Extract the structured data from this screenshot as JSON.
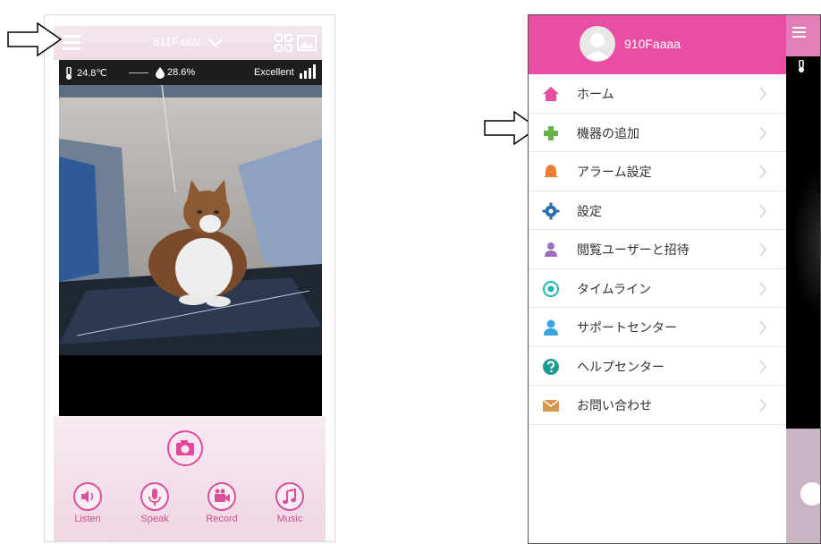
{
  "left_screen": {
    "device_name": "811Faaat",
    "temperature": "24.8℃",
    "humidity": "28.6%",
    "signal_label": "Excellent",
    "controls": [
      {
        "label": "Listen",
        "icon": "speaker-icon"
      },
      {
        "label": "Speak",
        "icon": "microphone-icon"
      },
      {
        "label": "Record",
        "icon": "video-camera-icon"
      },
      {
        "label": "Music",
        "icon": "music-note-icon"
      }
    ]
  },
  "right_screen": {
    "user_name": "910Faaaa",
    "menu_items": [
      {
        "label": "ホーム",
        "icon": "home-icon",
        "color": "#e94ea2"
      },
      {
        "label": "機器の追加",
        "icon": "plus-icon",
        "color": "#6bb24a"
      },
      {
        "label": "アラーム設定",
        "icon": "bell-icon",
        "color": "#f07b32"
      },
      {
        "label": "設定",
        "icon": "gear-icon",
        "color": "#2a6fb0"
      },
      {
        "label": "閲覧ユーザーと招待",
        "icon": "users-icon",
        "color": "#9b6fc0"
      },
      {
        "label": "タイムライン",
        "icon": "timeline-icon",
        "color": "#1fb7b0"
      },
      {
        "label": "サポートセンター",
        "icon": "support-person-icon",
        "color": "#3aa3e0"
      },
      {
        "label": "ヘルプセンター",
        "icon": "help-icon",
        "color": "#1e9b8f"
      },
      {
        "label": "お問い合わせ",
        "icon": "mail-icon",
        "color": "#d99548"
      }
    ]
  },
  "colors": {
    "accent_pink": "#e94ea2"
  }
}
